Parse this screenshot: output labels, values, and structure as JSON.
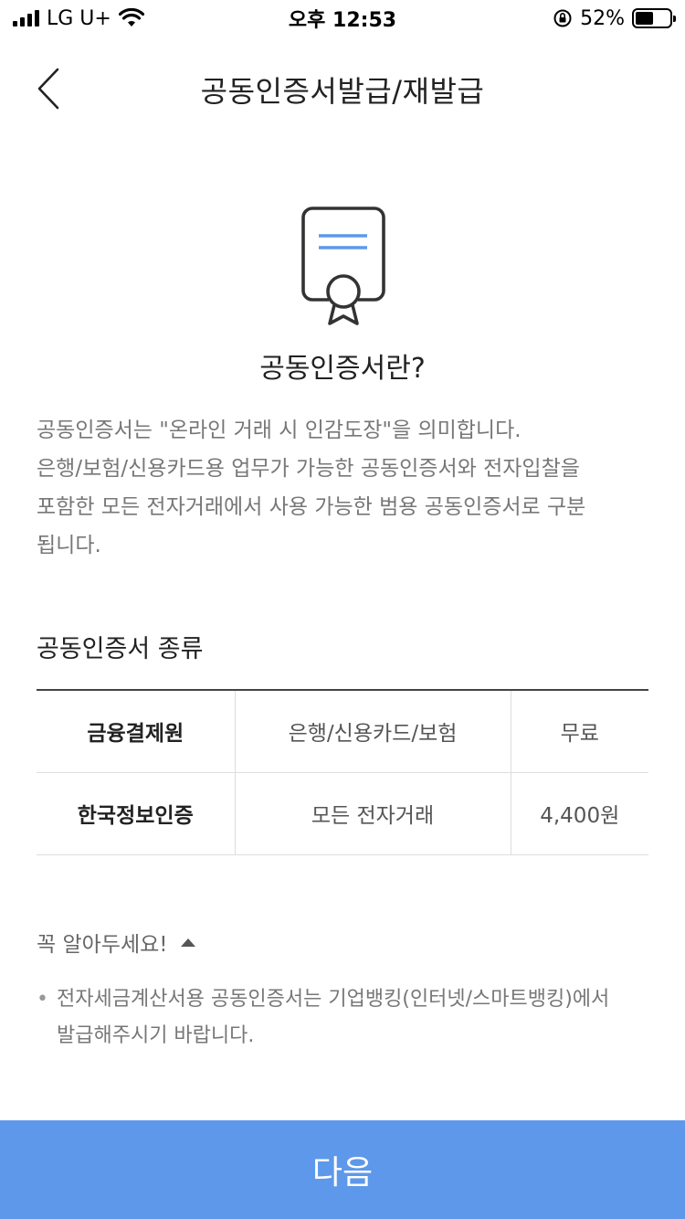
{
  "status_bar": {
    "carrier": "LG U+",
    "time": "오후 12:53",
    "battery_text": "52%",
    "battery_level": 0.52
  },
  "header": {
    "title": "공동인증서발급/재발급",
    "back_icon": "chevron-left-icon"
  },
  "intro": {
    "icon": "certificate-icon",
    "accent_color": "#5e98ea",
    "heading": "공동인증서란?",
    "lines": [
      "공동인증서는 \"온라인 거래 시 인감도장\"을 의미합니다.",
      "은행/보험/신용카드용 업무가 가능한 공동인증서와 전자입찰을",
      "포함한 모든 전자거래에서 사용 가능한 범용 공동인증서로 구분",
      "됩니다."
    ]
  },
  "types": {
    "heading": "공동인증서 종류",
    "rows": [
      {
        "name": "금융결제원",
        "scope": "은행/신용카드/보험",
        "fee": "무료"
      },
      {
        "name": "한국정보인증",
        "scope": "모든 전자거래",
        "fee": "4,400원"
      }
    ]
  },
  "notice": {
    "toggle_label": "꼭 알아두세요!",
    "toggle_icon": "triangle-up-icon",
    "items": [
      {
        "line1": "전자세금계산서용 공동인증서는 기업뱅킹(인터넷/스마트뱅킹)에서",
        "line2": "발급해주시기 바랍니다."
      }
    ]
  },
  "footer": {
    "next_label": "다음",
    "button_color": "#5e98ea"
  }
}
